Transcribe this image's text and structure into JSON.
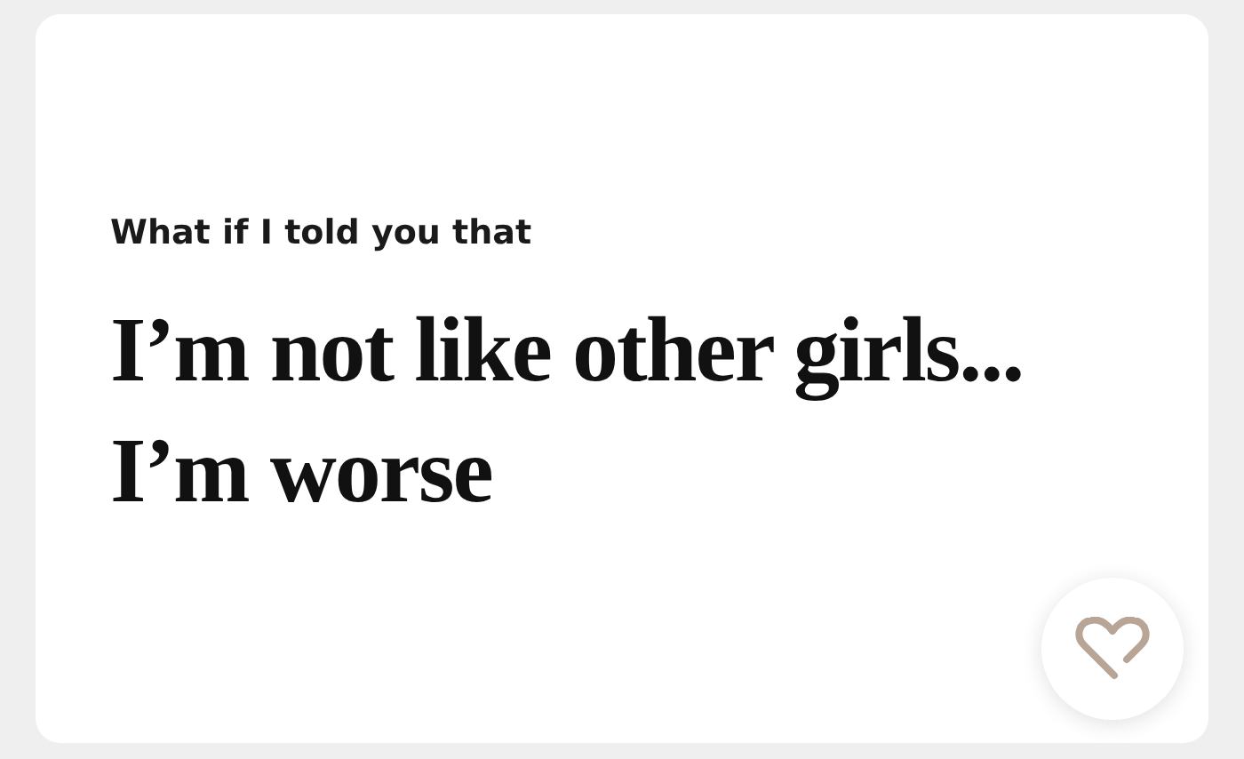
{
  "prompt": {
    "question": "What if I told you that",
    "answer": "I’m not like other girls... I’m worse"
  }
}
